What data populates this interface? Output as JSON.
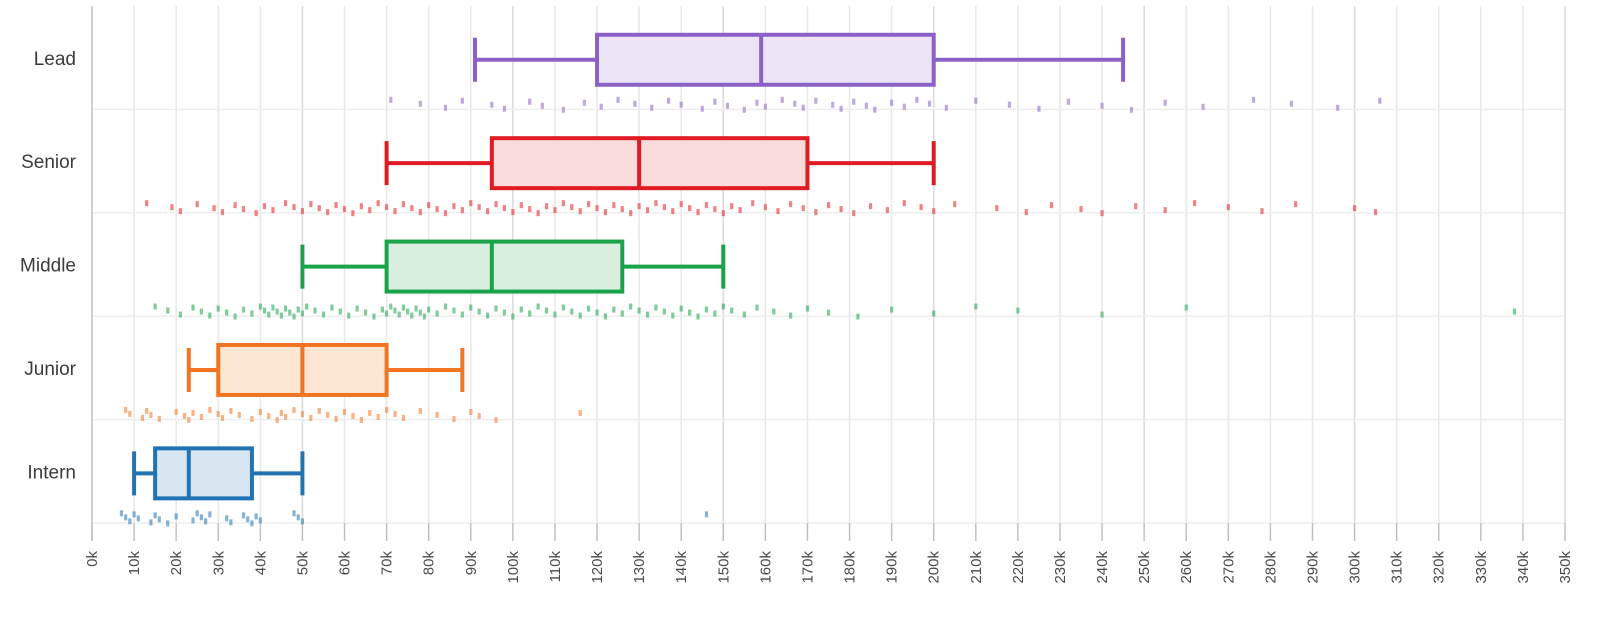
{
  "chart_data": {
    "type": "box",
    "title": "",
    "xlabel": "",
    "ylabel": "",
    "orientation": "horizontal",
    "xlim": [
      0,
      350
    ],
    "x_unit": "k",
    "grid": true,
    "legend": "none",
    "x_tick_labels": [
      "0k",
      "10k",
      "20k",
      "30k",
      "40k",
      "50k",
      "60k",
      "70k",
      "80k",
      "90k",
      "100k",
      "110k",
      "120k",
      "130k",
      "140k",
      "150k",
      "160k",
      "170k",
      "180k",
      "190k",
      "200k",
      "210k",
      "220k",
      "230k",
      "240k",
      "250k",
      "260k",
      "270k",
      "280k",
      "290k",
      "300k",
      "310k",
      "320k",
      "330k",
      "340k",
      "350k"
    ],
    "x_tick_values": [
      0,
      10,
      20,
      30,
      40,
      50,
      60,
      70,
      80,
      90,
      100,
      110,
      120,
      130,
      140,
      150,
      160,
      170,
      180,
      190,
      200,
      210,
      220,
      230,
      240,
      250,
      260,
      270,
      280,
      290,
      300,
      310,
      320,
      330,
      340,
      350
    ],
    "categories": [
      "Lead",
      "Senior",
      "Middle",
      "Junior",
      "Intern"
    ],
    "boxes": [
      {
        "label": "Lead",
        "color": "#8c61c7",
        "fill": "#ece4f6",
        "whisker_low": 91,
        "q1": 120,
        "median": 159,
        "q3": 200,
        "whisker_high": 245,
        "points": [
          71,
          78,
          84,
          88,
          95,
          98,
          104,
          107,
          112,
          117,
          121,
          125,
          129,
          133,
          137,
          140,
          145,
          148,
          151,
          155,
          158,
          160,
          164,
          167,
          169,
          172,
          176,
          178,
          181,
          184,
          186,
          190,
          193,
          196,
          199,
          203,
          210,
          218,
          225,
          232,
          240,
          247,
          255,
          264,
          276,
          285,
          296,
          306
        ]
      },
      {
        "label": "Senior",
        "color": "#e01b24",
        "fill": "#fadbdb",
        "whisker_low": 70,
        "q1": 95,
        "median": 130,
        "q3": 170,
        "whisker_high": 200,
        "points": [
          13,
          19,
          21,
          25,
          29,
          31,
          34,
          36,
          39,
          41,
          43,
          46,
          48,
          50,
          52,
          54,
          56,
          58,
          60,
          62,
          64,
          66,
          68,
          70,
          72,
          74,
          76,
          78,
          80,
          82,
          84,
          86,
          88,
          90,
          92,
          94,
          96,
          98,
          100,
          102,
          104,
          106,
          108,
          110,
          112,
          114,
          116,
          118,
          120,
          122,
          124,
          126,
          128,
          130,
          132,
          134,
          136,
          138,
          140,
          142,
          144,
          146,
          148,
          150,
          152,
          154,
          157,
          160,
          163,
          166,
          169,
          172,
          175,
          178,
          181,
          185,
          189,
          193,
          197,
          200,
          205,
          215,
          222,
          228,
          235,
          240,
          248,
          255,
          262,
          270,
          278,
          286,
          300,
          305
        ]
      },
      {
        "label": "Middle",
        "color": "#1aa34a",
        "fill": "#d9eedf",
        "whisker_low": 50,
        "q1": 70,
        "median": 95,
        "q3": 126,
        "whisker_high": 150,
        "points": [
          15,
          18,
          21,
          24,
          26,
          28,
          30,
          32,
          34,
          36,
          38,
          40,
          41,
          42,
          43,
          44,
          45,
          46,
          47,
          48,
          49,
          50,
          51,
          53,
          55,
          57,
          59,
          61,
          63,
          65,
          67,
          69,
          70,
          71,
          72,
          73,
          74,
          75,
          76,
          77,
          78,
          79,
          80,
          82,
          84,
          86,
          88,
          90,
          92,
          94,
          96,
          98,
          100,
          102,
          104,
          106,
          108,
          110,
          112,
          114,
          116,
          118,
          120,
          122,
          124,
          126,
          128,
          130,
          132,
          134,
          136,
          138,
          140,
          142,
          144,
          146,
          148,
          150,
          152,
          155,
          158,
          162,
          166,
          170,
          175,
          182,
          190,
          200,
          210,
          220,
          240,
          260,
          338
        ]
      },
      {
        "label": "Junior",
        "color": "#f07422",
        "fill": "#fde6d2",
        "whisker_low": 23,
        "q1": 30,
        "median": 50,
        "q3": 70,
        "whisker_high": 88,
        "points": [
          8,
          9,
          12,
          13,
          14,
          16,
          20,
          22,
          23,
          24,
          26,
          28,
          30,
          31,
          33,
          35,
          38,
          40,
          42,
          44,
          45,
          46,
          48,
          50,
          52,
          54,
          56,
          58,
          60,
          62,
          64,
          66,
          68,
          70,
          72,
          74,
          78,
          82,
          86,
          90,
          92,
          96,
          116
        ]
      },
      {
        "label": "Intern",
        "color": "#2273b3",
        "fill": "#d8e6f2",
        "whisker_low": 10,
        "q1": 15,
        "median": 23,
        "q3": 38,
        "whisker_high": 50,
        "points": [
          7,
          8,
          9,
          10,
          11,
          14,
          15,
          16,
          18,
          20,
          24,
          25,
          26,
          27,
          28,
          32,
          33,
          36,
          37,
          38,
          39,
          40,
          48,
          49,
          50,
          146
        ]
      }
    ]
  }
}
